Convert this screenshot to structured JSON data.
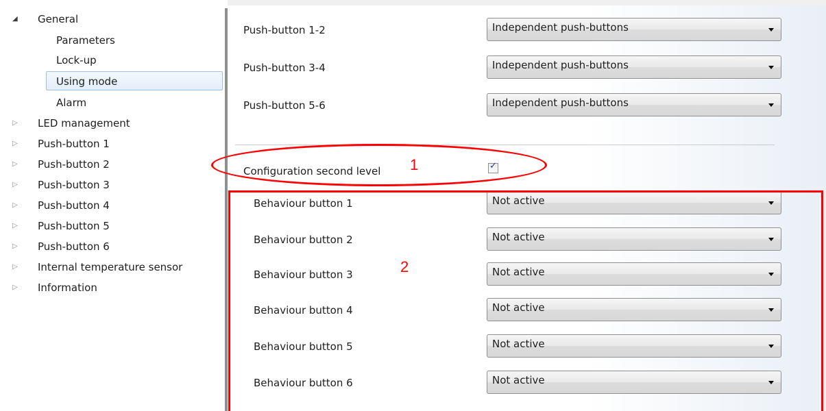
{
  "sidebar": {
    "items": [
      {
        "label": "General",
        "arrow": "◢"
      },
      {
        "label": "Parameters"
      },
      {
        "label": "Lock-up"
      },
      {
        "label": "Using mode"
      },
      {
        "label": "Alarm"
      },
      {
        "label": "LED management",
        "arrow": "▷"
      },
      {
        "label": "Push-button 1",
        "arrow": "▷"
      },
      {
        "label": "Push-button 2",
        "arrow": "▷"
      },
      {
        "label": "Push-button 3",
        "arrow": "▷"
      },
      {
        "label": "Push-button 4",
        "arrow": "▷"
      },
      {
        "label": "Push-button 5",
        "arrow": "▷"
      },
      {
        "label": "Push-button 6",
        "arrow": "▷"
      },
      {
        "label": "Internal temperature sensor",
        "arrow": "▷"
      },
      {
        "label": "Information",
        "arrow": "▷"
      }
    ],
    "selected": "Using mode"
  },
  "main": {
    "push_button_params": [
      {
        "label": "Push-button 1-2",
        "value": "Independent push-buttons"
      },
      {
        "label": "Push-button 3-4",
        "value": "Independent push-buttons"
      },
      {
        "label": "Push-button 5-6",
        "value": "Independent push-buttons"
      }
    ],
    "configuration_second_level": {
      "label": "Configuration second level",
      "checked": true,
      "check_glyph": "✓"
    },
    "behaviour_params": [
      {
        "label": "Behaviour button 1",
        "value": "Not active"
      },
      {
        "label": "Behaviour button 2",
        "value": "Not active"
      },
      {
        "label": "Behaviour button 3",
        "value": "Not active"
      },
      {
        "label": "Behaviour button 4",
        "value": "Not active"
      },
      {
        "label": "Behaviour button 5",
        "value": "Not active"
      },
      {
        "label": "Behaviour button 6",
        "value": "Not active"
      }
    ]
  },
  "annotations": {
    "marker_1": "1",
    "marker_2": "2",
    "color": "#ff0000"
  },
  "icons": {
    "expanded_arrow": "tree-expanded-arrow-icon",
    "collapsed_arrow": "tree-collapsed-arrow-icon",
    "dropdown_caret": "chevron-down-icon",
    "checkmark": "checkmark-icon"
  }
}
